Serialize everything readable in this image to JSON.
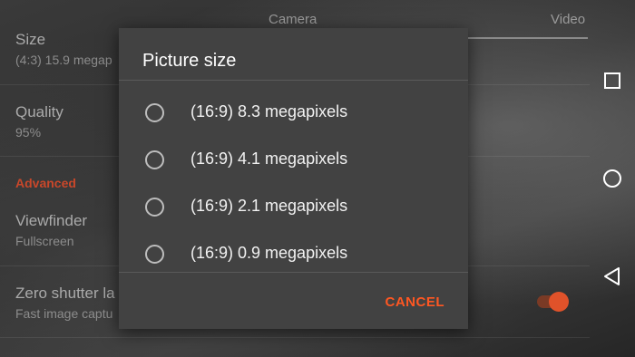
{
  "tabs": {
    "camera": "Camera",
    "video": "Video"
  },
  "settings": {
    "size": {
      "title": "Size",
      "summary": "(4:3) 15.9 megap"
    },
    "quality": {
      "title": "Quality",
      "summary": "95%"
    },
    "category": "Advanced",
    "viewfinder": {
      "title": "Viewfinder",
      "summary": "Fullscreen"
    },
    "zero_shutter": {
      "title": "Zero shutter la",
      "summary": "Fast image captu",
      "toggle_on": true
    }
  },
  "dialog": {
    "title": "Picture size",
    "options": [
      {
        "label": "(16:9) 8.3 megapixels",
        "selected": false
      },
      {
        "label": "(16:9) 4.1 megapixels",
        "selected": false
      },
      {
        "label": "(16:9) 2.1 megapixels",
        "selected": false
      },
      {
        "label": "(16:9) 0.9 megapixels",
        "selected": false
      }
    ],
    "cancel": "CANCEL"
  },
  "colors": {
    "accent": "#FF5722",
    "dialog_bg": "#424242"
  },
  "icons": {
    "recents": "square-icon",
    "home": "circle-icon",
    "back": "triangle-back-icon"
  }
}
